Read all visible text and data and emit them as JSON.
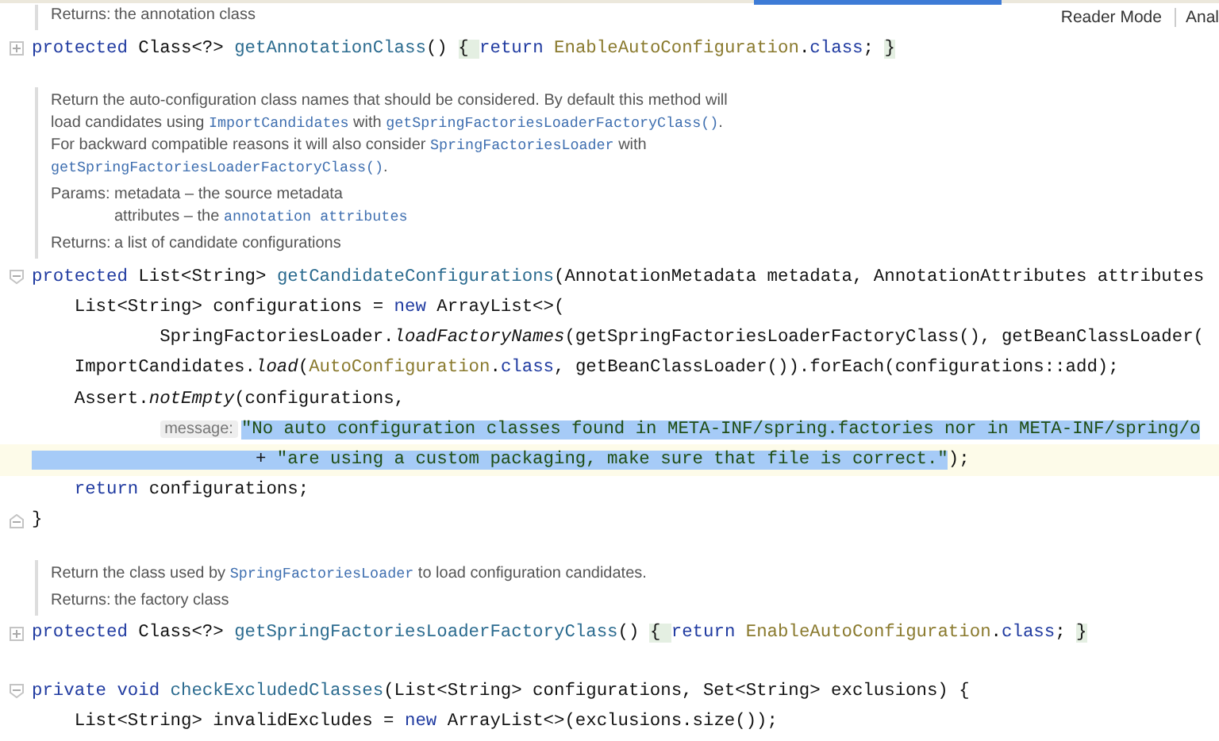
{
  "editor_tabs": {
    "active_tab_indicator": true
  },
  "reader_toolbar": [
    "Reader Mode",
    "Anal"
  ],
  "blocks": [
    {
      "kind": "doc",
      "returns": {
        "label": "Returns:",
        "text": [
          {
            "kind": "text",
            "t": "the annotation class"
          }
        ]
      }
    },
    {
      "kind": "code",
      "lines": [
        {
          "kind": "collapsed",
          "current": false,
          "tokens": [
            {
              "kind": "kw",
              "t": "protected"
            },
            {
              "kind": "plain",
              "t": " Class<?> "
            },
            {
              "kind": "fn",
              "t": "getAnnotationClass"
            },
            {
              "kind": "plain",
              "t": "() "
            },
            {
              "kind": "folded",
              "t": "{ "
            },
            {
              "kind": "kw",
              "t": "return "
            },
            {
              "kind": "cls",
              "t": "EnableAutoConfiguration"
            },
            {
              "kind": "plain",
              "t": "."
            },
            {
              "kind": "kw",
              "t": "class"
            },
            {
              "kind": "plain",
              "t": "; "
            },
            {
              "kind": "folded",
              "t": "}"
            }
          ]
        }
      ]
    },
    {
      "kind": "doc",
      "description": [
        [
          {
            "kind": "text",
            "t": "Return the auto-configuration class names that should be considered. By default this method will"
          }
        ],
        [
          {
            "kind": "text",
            "t": "load candidates using "
          },
          {
            "kind": "link",
            "t": "ImportCandidates"
          },
          {
            "kind": "text",
            "t": " with "
          },
          {
            "kind": "link",
            "t": "getSpringFactoriesLoaderFactoryClass()"
          },
          {
            "kind": "text",
            "t": "."
          }
        ],
        [
          {
            "kind": "text",
            "t": "For backward compatible reasons it will also consider "
          },
          {
            "kind": "link",
            "t": "SpringFactoriesLoader"
          },
          {
            "kind": "text",
            "t": " with"
          }
        ],
        [
          {
            "kind": "link",
            "t": "getSpringFactoriesLoaderFactoryClass()"
          },
          {
            "kind": "text",
            "t": "."
          }
        ]
      ],
      "params": {
        "label": "Params:",
        "entries": [
          [
            {
              "kind": "text",
              "t": "metadata – the source metadata"
            }
          ],
          [
            {
              "kind": "text",
              "t": "attributes – the "
            },
            {
              "kind": "link",
              "t": "annotation attributes"
            }
          ]
        ]
      },
      "returns": {
        "label": "Returns:",
        "text": [
          {
            "kind": "text",
            "t": "a list of candidate configurations"
          }
        ]
      }
    },
    {
      "kind": "code",
      "lines": [
        {
          "kind": "fold_start",
          "current": false,
          "tokens": [
            {
              "kind": "kw",
              "t": "protected"
            },
            {
              "kind": "plain",
              "t": " List<String> "
            },
            {
              "kind": "fn",
              "t": "getCandidateConfigurations"
            },
            {
              "kind": "plain",
              "t": "(AnnotationMetadata metadata, AnnotationAttributes attributes"
            }
          ]
        },
        {
          "kind": "plain",
          "current": false,
          "tokens": [
            {
              "kind": "plain",
              "t": "    List<String> configurations = "
            },
            {
              "kind": "kw",
              "t": "new"
            },
            {
              "kind": "plain",
              "t": " ArrayList<>("
            }
          ]
        },
        {
          "kind": "plain",
          "current": false,
          "tokens": [
            {
              "kind": "plain",
              "t": "            SpringFactoriesLoader."
            },
            {
              "kind": "it",
              "t": "loadFactoryNames"
            },
            {
              "kind": "plain",
              "t": "(getSpringFactoriesLoaderFactoryClass(), getBeanClassLoader("
            }
          ]
        },
        {
          "kind": "plain",
          "current": false,
          "tokens": [
            {
              "kind": "plain",
              "t": "    ImportCandidates."
            },
            {
              "kind": "it",
              "t": "load"
            },
            {
              "kind": "plain",
              "t": "("
            },
            {
              "kind": "cls",
              "t": "AutoConfiguration"
            },
            {
              "kind": "plain",
              "t": "."
            },
            {
              "kind": "kw",
              "t": "class"
            },
            {
              "kind": "plain",
              "t": ", getBeanClassLoader()).forEach(configurations::add);"
            }
          ]
        },
        {
          "kind": "plain",
          "current": false,
          "tokens": [
            {
              "kind": "plain",
              "t": "    Assert."
            },
            {
              "kind": "it",
              "t": "notEmpty"
            },
            {
              "kind": "plain",
              "t": "(configurations,"
            }
          ]
        },
        {
          "kind": "plain",
          "current": false,
          "tokens": [
            {
              "kind": "hint",
              "t": "            message:"
            },
            {
              "kind": "str",
              "selected": true,
              "t": "\"No auto configuration classes found in META-INF/spring.factories nor in META-INF/spring/o"
            }
          ]
        },
        {
          "kind": "plain",
          "current": true,
          "tokens": [
            {
              "kind": "plain",
              "selected": true,
              "t": "                     + "
            },
            {
              "kind": "str",
              "selected": true,
              "t": "\"are using a custom packaging, make sure that file is correct.\""
            },
            {
              "kind": "plain",
              "t": ");"
            }
          ]
        },
        {
          "kind": "plain",
          "current": false,
          "tokens": [
            {
              "kind": "kw",
              "t": "    return"
            },
            {
              "kind": "plain",
              "t": " configurations;"
            }
          ]
        },
        {
          "kind": "fold_end",
          "current": false,
          "tokens": [
            {
              "kind": "plain",
              "t": "}"
            }
          ]
        }
      ]
    },
    {
      "kind": "doc",
      "description": [
        [
          {
            "kind": "text",
            "t": "Return the class used by "
          },
          {
            "kind": "link",
            "t": "SpringFactoriesLoader"
          },
          {
            "kind": "text",
            "t": " to load configuration candidates."
          }
        ]
      ],
      "returns": {
        "label": "Returns:",
        "text": [
          {
            "kind": "text",
            "t": "the factory class"
          }
        ]
      }
    },
    {
      "kind": "code",
      "lines": [
        {
          "kind": "collapsed",
          "current": false,
          "tokens": [
            {
              "kind": "kw",
              "t": "protected"
            },
            {
              "kind": "plain",
              "t": " Class<?> "
            },
            {
              "kind": "fn",
              "t": "getSpringFactoriesLoaderFactoryClass"
            },
            {
              "kind": "plain",
              "t": "() "
            },
            {
              "kind": "folded",
              "t": "{ "
            },
            {
              "kind": "kw",
              "t": "return "
            },
            {
              "kind": "cls",
              "t": "EnableAutoConfiguration"
            },
            {
              "kind": "plain",
              "t": "."
            },
            {
              "kind": "kw",
              "t": "class"
            },
            {
              "kind": "plain",
              "t": "; "
            },
            {
              "kind": "folded",
              "t": "}"
            }
          ]
        }
      ]
    },
    {
      "kind": "code",
      "lines": [
        {
          "kind": "fold_start",
          "current": false,
          "tokens": [
            {
              "kind": "kw",
              "t": "private void "
            },
            {
              "kind": "fn",
              "t": "checkExcludedClasses"
            },
            {
              "kind": "plain",
              "t": "(List<String> configurations, Set<String> exclusions) {"
            }
          ]
        },
        {
          "kind": "plain",
          "current": false,
          "tokens": [
            {
              "kind": "plain",
              "t": "    List<String> invalidExcludes = "
            },
            {
              "kind": "kw",
              "t": "new"
            },
            {
              "kind": "plain",
              "t": " ArrayList<>(exclusions.size());"
            }
          ]
        }
      ]
    }
  ]
}
